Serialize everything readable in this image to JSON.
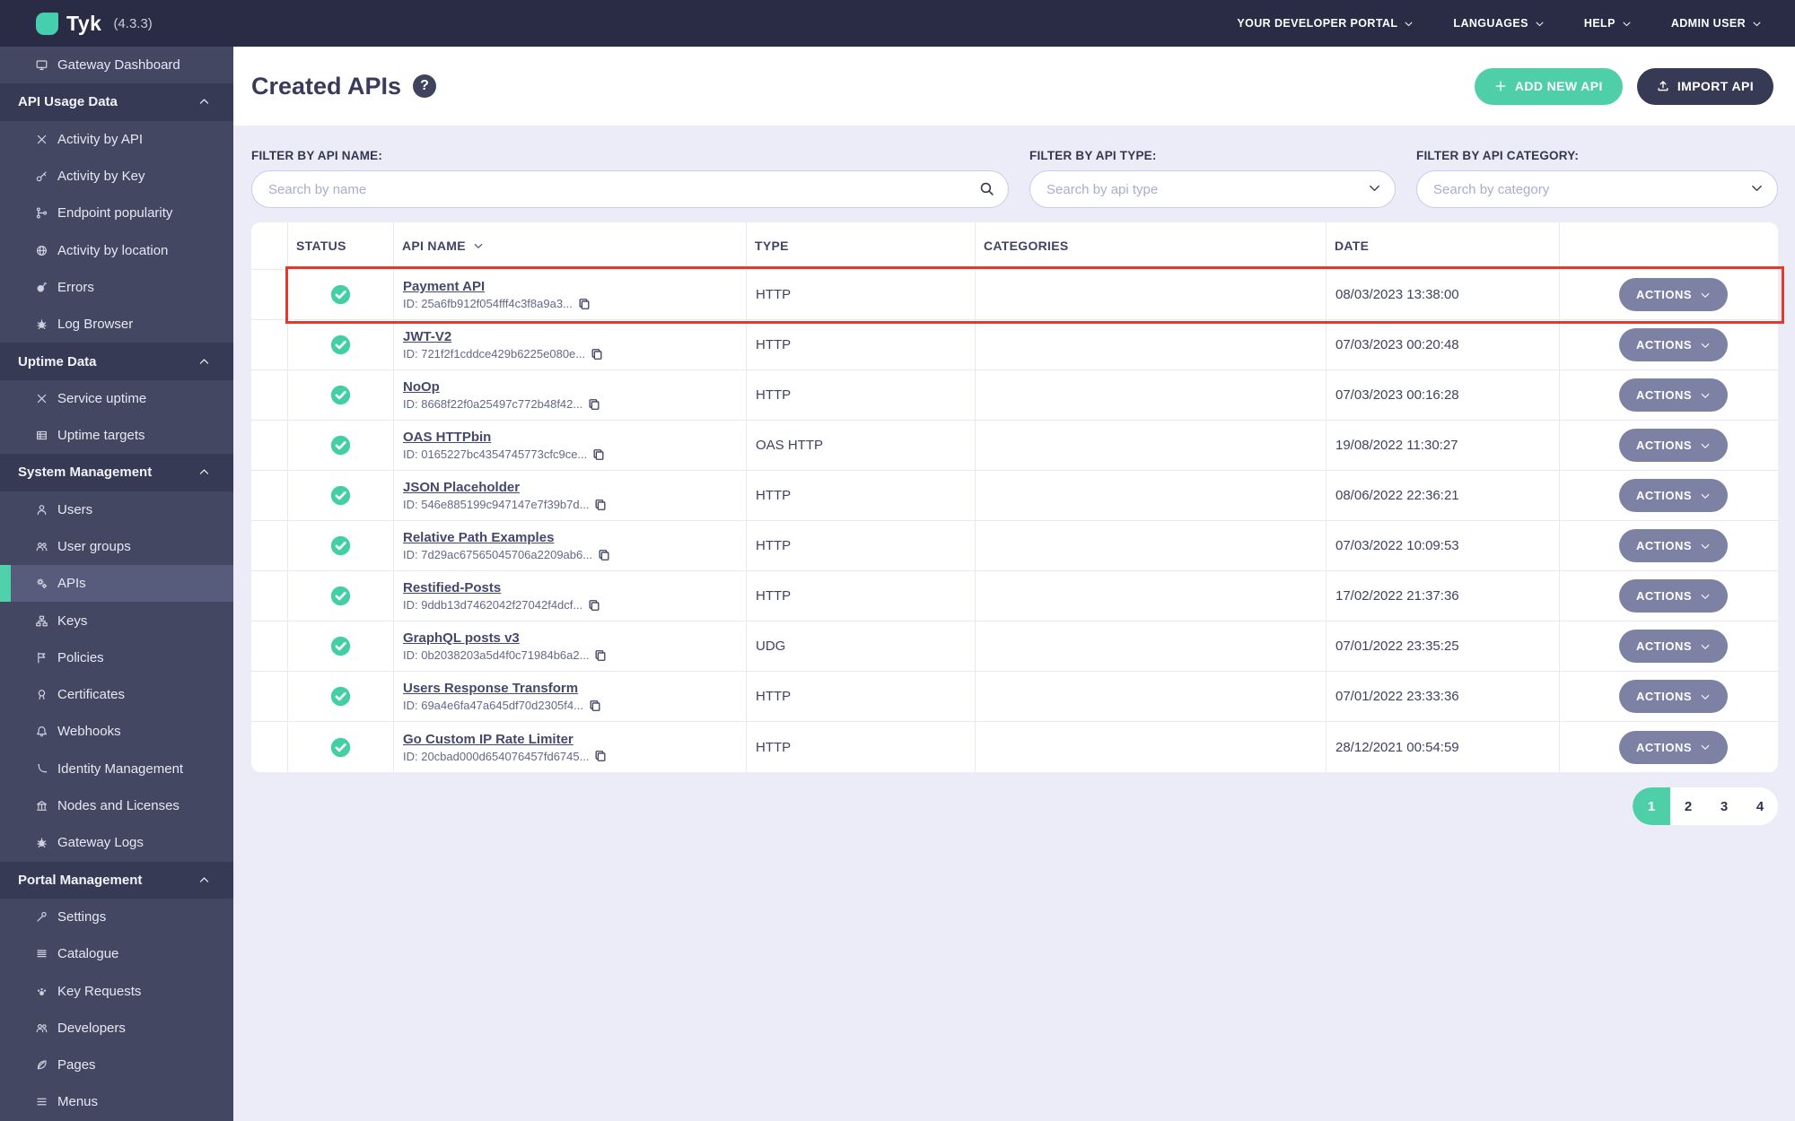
{
  "topbar": {
    "brand": "Tyk",
    "version": "(4.3.3)",
    "menus": [
      {
        "label": "YOUR DEVELOPER PORTAL"
      },
      {
        "label": "LANGUAGES"
      },
      {
        "label": "HELP"
      },
      {
        "label": "ADMIN USER"
      }
    ]
  },
  "sidebar": {
    "items": [
      {
        "type": "link",
        "icon": "monitor",
        "label": "Gateway Dashboard"
      },
      {
        "type": "section",
        "label": "API Usage Data"
      },
      {
        "type": "link",
        "icon": "tools",
        "label": "Activity by API"
      },
      {
        "type": "link",
        "icon": "key",
        "label": "Activity by Key"
      },
      {
        "type": "link",
        "icon": "branch",
        "label": "Endpoint popularity"
      },
      {
        "type": "link",
        "icon": "globe",
        "label": "Activity by location"
      },
      {
        "type": "link",
        "icon": "bomb",
        "label": "Errors"
      },
      {
        "type": "link",
        "icon": "bug",
        "label": "Log Browser"
      },
      {
        "type": "section",
        "label": "Uptime Data"
      },
      {
        "type": "link",
        "icon": "tools",
        "label": "Service uptime"
      },
      {
        "type": "link",
        "icon": "grid",
        "label": "Uptime targets"
      },
      {
        "type": "section",
        "label": "System Management"
      },
      {
        "type": "link",
        "icon": "person",
        "label": "Users"
      },
      {
        "type": "link",
        "icon": "people",
        "label": "User groups"
      },
      {
        "type": "link",
        "icon": "gears",
        "label": "APIs",
        "selected": true
      },
      {
        "type": "link",
        "icon": "sitemap",
        "label": "Keys"
      },
      {
        "type": "link",
        "icon": "flag",
        "label": "Policies"
      },
      {
        "type": "link",
        "icon": "seal",
        "label": "Certificates"
      },
      {
        "type": "link",
        "icon": "bell",
        "label": "Webhooks"
      },
      {
        "type": "link",
        "icon": "hook",
        "label": "Identity Management"
      },
      {
        "type": "link",
        "icon": "bank",
        "label": "Nodes and Licenses"
      },
      {
        "type": "link",
        "icon": "bug",
        "label": "Gateway Logs"
      },
      {
        "type": "section",
        "label": "Portal Management"
      },
      {
        "type": "link",
        "icon": "wrench",
        "label": "Settings"
      },
      {
        "type": "link",
        "icon": "list",
        "label": "Catalogue"
      },
      {
        "type": "link",
        "icon": "paw",
        "label": "Key Requests"
      },
      {
        "type": "link",
        "icon": "people",
        "label": "Developers"
      },
      {
        "type": "link",
        "icon": "leaf",
        "label": "Pages"
      },
      {
        "type": "link",
        "icon": "bars",
        "label": "Menus"
      }
    ]
  },
  "page": {
    "title": "Created APIs",
    "help_text": "?",
    "add_button": "ADD NEW API",
    "import_button": "IMPORT API"
  },
  "filters": {
    "name": {
      "label": "FILTER BY API NAME:",
      "placeholder": "Search by name"
    },
    "type": {
      "label": "FILTER BY API TYPE:",
      "placeholder": "Search by api type"
    },
    "category": {
      "label": "FILTER BY API CATEGORY:",
      "placeholder": "Search by category"
    }
  },
  "table": {
    "columns": [
      "STATUS",
      "API NAME",
      "TYPE",
      "CATEGORIES",
      "DATE"
    ],
    "actions_label": "ACTIONS",
    "rows": [
      {
        "status": "active",
        "name": "Payment API",
        "id": "ID: 25a6fb912f054fff4c3f8a9a3...",
        "type": "HTTP",
        "categories": "",
        "date": "08/03/2023 13:38:00",
        "highlighted": true
      },
      {
        "status": "active",
        "name": "JWT-V2",
        "id": "ID: 721f2f1cddce429b6225e080e...",
        "type": "HTTP",
        "categories": "",
        "date": "07/03/2023 00:20:48"
      },
      {
        "status": "active",
        "name": "NoOp",
        "id": "ID: 8668f22f0a25497c772b48f42...",
        "type": "HTTP",
        "categories": "",
        "date": "07/03/2023 00:16:28"
      },
      {
        "status": "active",
        "name": "OAS HTTPbin",
        "id": "ID: 0165227bc4354745773cfc9ce...",
        "type": "OAS HTTP",
        "categories": "",
        "date": "19/08/2022 11:30:27"
      },
      {
        "status": "active",
        "name": "JSON Placeholder",
        "id": "ID: 546e885199c947147e7f39b7d...",
        "type": "HTTP",
        "categories": "",
        "date": "08/06/2022 22:36:21"
      },
      {
        "status": "active",
        "name": "Relative Path Examples",
        "id": "ID: 7d29ac67565045706a2209ab6...",
        "type": "HTTP",
        "categories": "",
        "date": "07/03/2022 10:09:53"
      },
      {
        "status": "active",
        "name": "Restified-Posts",
        "id": "ID: 9ddb13d7462042f27042f4dcf...",
        "type": "HTTP",
        "categories": "",
        "date": "17/02/2022 21:37:36"
      },
      {
        "status": "active",
        "name": "GraphQL posts v3",
        "id": "ID: 0b2038203a5d4f0c71984b6a2...",
        "type": "UDG",
        "categories": "",
        "date": "07/01/2022 23:35:25"
      },
      {
        "status": "active",
        "name": "Users Response Transform",
        "id": "ID: 69a4e6fa47a645df70d2305f4...",
        "type": "HTTP",
        "categories": "",
        "date": "07/01/2022 23:33:36"
      },
      {
        "status": "active",
        "name": "Go Custom IP Rate Limiter",
        "id": "ID: 20cbad000d654076457fd6745...",
        "type": "HTTP",
        "categories": "",
        "date": "28/12/2021 00:54:59"
      }
    ]
  },
  "pagination": {
    "pages": [
      "1",
      "2",
      "3",
      "4"
    ],
    "active": "1"
  },
  "colors": {
    "brand_teal": "#4ecfa7",
    "topbar_navy": "#292c44",
    "sidebar_navy": "#434762",
    "sidebar_section_navy": "#363a55",
    "selected_item": "#585c7c",
    "highlight_red": "#e23b2c",
    "status_green": "#41cfa3",
    "actions_gray": "#7d81a3",
    "background_lavender": "#ebecf8"
  }
}
